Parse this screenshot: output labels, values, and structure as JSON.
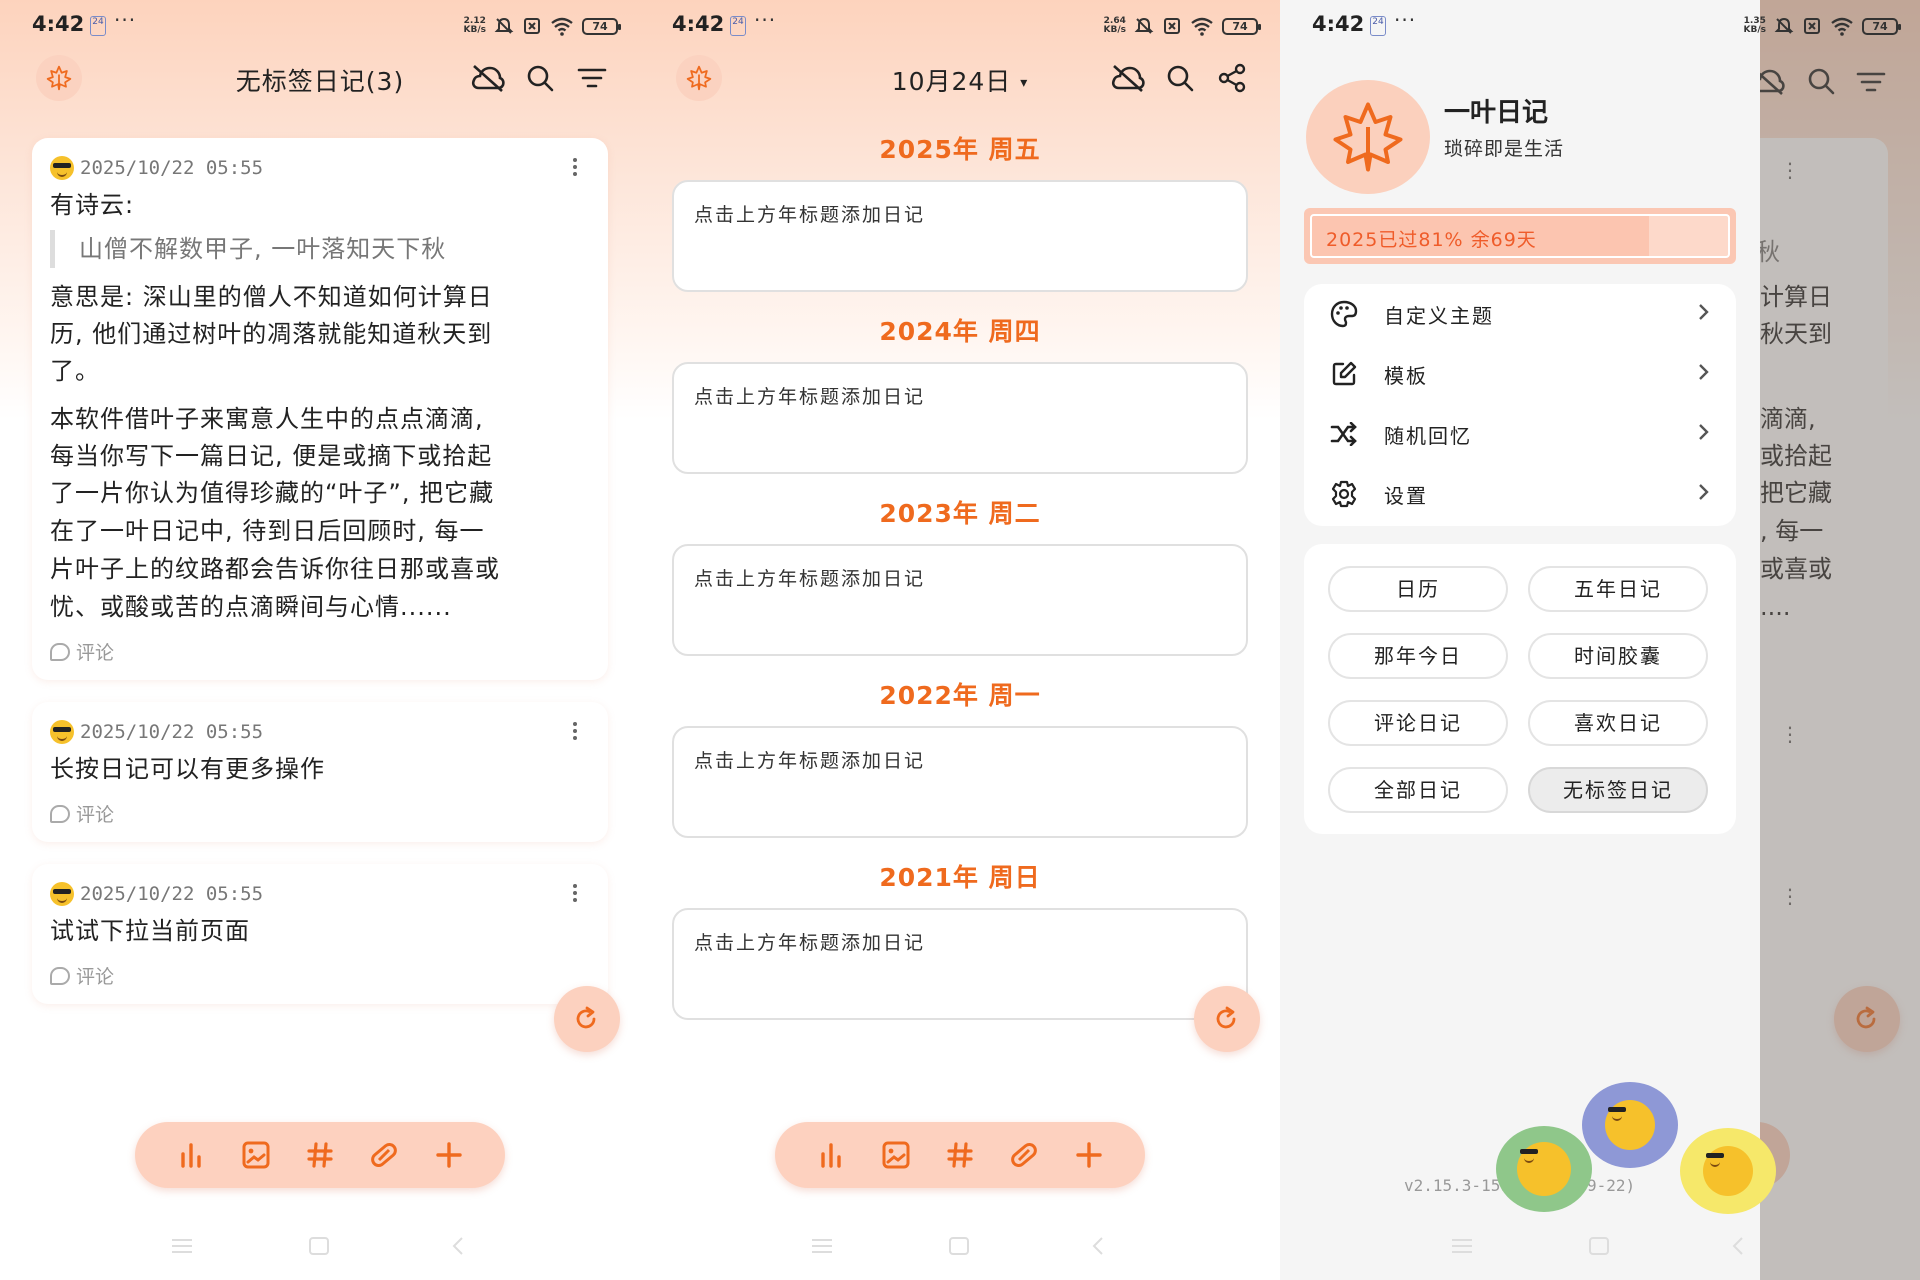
{
  "status_bars": [
    {
      "time": "4:42",
      "badge": "24",
      "dots": "···",
      "speed_top": "2.12",
      "speed_bottom": "KB/s",
      "battery": "74"
    },
    {
      "time": "4:42",
      "badge": "24",
      "dots": "···",
      "speed_top": "2.64",
      "speed_bottom": "KB/s",
      "battery": "74"
    },
    {
      "time": "4:42",
      "badge": "24",
      "dots": "···",
      "speed_top": "1.35",
      "speed_bottom": "KB/s",
      "battery": "74"
    }
  ],
  "screen1": {
    "title": "无标签日记(3)",
    "cards": [
      {
        "date": "2025/10/22 05:55",
        "line1": "有诗云:",
        "quote": "山僧不解数甲子, 一叶落知天下秋",
        "para1_l1": "意思是: 深山里的僧人不知道如何计算日",
        "para1_l2": "历, 他们通过树叶的凋落就能知道秋天到",
        "para1_l3": "了。",
        "para2_l1": "本软件借叶子来寓意人生中的点点滴滴,",
        "para2_l2": "每当你写下一篇日记, 便是或摘下或拾起",
        "para2_l3": "了一片你认为值得珍藏的“叶子”, 把它藏",
        "para2_l4": "在了一叶日记中, 待到日后回顾时, 每一",
        "para2_l5": "片叶子上的纹路都会告诉你往日那或喜或",
        "para2_l6": "忧、或酸或苦的点滴瞬间与心情......",
        "comment": "评论"
      },
      {
        "date": "2025/10/22 05:55",
        "text": "长按日记可以有更多操作",
        "comment": "评论"
      },
      {
        "date": "2025/10/22 05:55",
        "text": "试试下拉当前页面",
        "comment": "评论"
      }
    ]
  },
  "screen2": {
    "title": "10月24日",
    "years": [
      {
        "title": "2025年  周五",
        "placeholder": "点击上方年标题添加日记"
      },
      {
        "title": "2024年  周四",
        "placeholder": "点击上方年标题添加日记"
      },
      {
        "title": "2023年  周二",
        "placeholder": "点击上方年标题添加日记"
      },
      {
        "title": "2022年  周一",
        "placeholder": "点击上方年标题添加日记"
      },
      {
        "title": "2021年  周日",
        "placeholder": "点击上方年标题添加日记"
      }
    ]
  },
  "screen3": {
    "app_name": "一叶日记",
    "slogan": "琐碎即是生活",
    "progress_label": "2025已过81%  余69天",
    "progress_fraction": 0.81,
    "menu": [
      {
        "label": "自定义主题",
        "icon": "palette-icon"
      },
      {
        "label": "模板",
        "icon": "edit-square-icon"
      },
      {
        "label": "随机回忆",
        "icon": "shuffle-icon"
      },
      {
        "label": "设置",
        "icon": "gear-icon"
      }
    ],
    "chips": [
      "日历",
      "五年日记",
      "那年今日",
      "时间胶囊",
      "评论日记",
      "喜欢日记",
      "全部日记",
      "无标签日记"
    ],
    "active_chip": "无标签日记",
    "version": "v2.15.3-159 (2025-09-22)",
    "behind_text": [
      "秋",
      "计算日",
      "秋天到",
      "滴滴,",
      "或拾起",
      "把它藏",
      ", 每一",
      "或喜或",
      "...."
    ]
  },
  "colors": {
    "accent": "#ef6a1e",
    "accent_soft": "#fcd1bf",
    "chip_active": "#ececec"
  }
}
